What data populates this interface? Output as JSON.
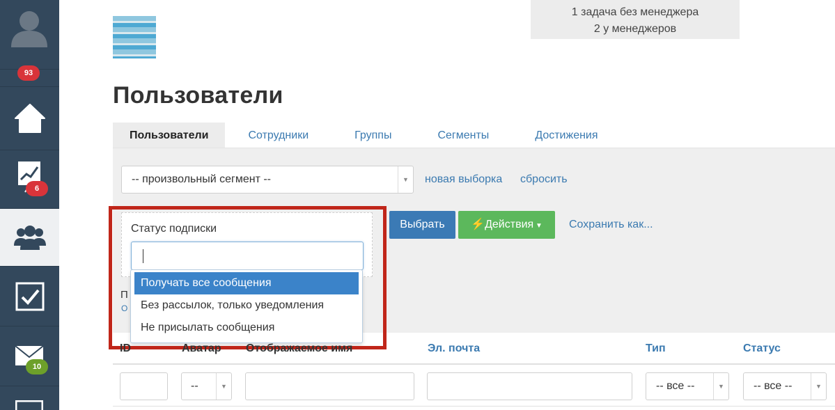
{
  "sidebar": {
    "items": [
      {
        "name": "profile",
        "icon": "user-avatar-icon",
        "badge": "93",
        "badge_color": "#d9343a"
      },
      {
        "name": "home",
        "icon": "home-icon"
      },
      {
        "name": "stats",
        "icon": "chart-icon",
        "badge": "6",
        "badge_color": "#d9343a"
      },
      {
        "name": "users",
        "icon": "users-icon",
        "active": true
      },
      {
        "name": "tasks",
        "icon": "checkbox-icon"
      },
      {
        "name": "messages",
        "icon": "envelope-icon",
        "badge": "10",
        "badge_color": "#6da02a"
      },
      {
        "name": "more",
        "icon": "calendar-icon"
      }
    ]
  },
  "tasks_summary": {
    "line1": "1 задача без менеджера",
    "line2": "2 у менеджеров"
  },
  "page_title": "Пользователи",
  "tabs": [
    {
      "label": "Пользователи",
      "active": true
    },
    {
      "label": "Сотрудники"
    },
    {
      "label": "Группы"
    },
    {
      "label": "Сегменты"
    },
    {
      "label": "Достижения"
    }
  ],
  "segment_select": {
    "value": "-- произвольный сегмент --"
  },
  "links": {
    "new_selection": "новая выборка",
    "reset": "сбросить",
    "save_as": "Сохранить как..."
  },
  "buttons": {
    "select": "Выбрать",
    "actions": "Действия"
  },
  "popover": {
    "label": "Статус подписки",
    "input_value": "",
    "options": [
      {
        "label": "Получать все сообщения",
        "selected": true
      },
      {
        "label": "Без рассылок, только уведомления"
      },
      {
        "label": "Не присылать сообщения"
      }
    ]
  },
  "behind": {
    "text_fragment": "П",
    "link_fragment": "О"
  },
  "table": {
    "headers": {
      "id": "ID",
      "avatar": "Аватар",
      "display_name": "Отображаемое имя",
      "email": "Эл. почта",
      "type": "Тип",
      "status": "Статус"
    },
    "filters": {
      "avatar": "--",
      "type": "-- все --",
      "status": "-- все --"
    }
  },
  "colors": {
    "sidebar_bg": "#33485c",
    "link": "#3b7ab0",
    "primary_button": "#3b7ab5",
    "success_button": "#5cb85c",
    "highlight_border": "#c0261a",
    "selected_option": "#3b83c9"
  }
}
